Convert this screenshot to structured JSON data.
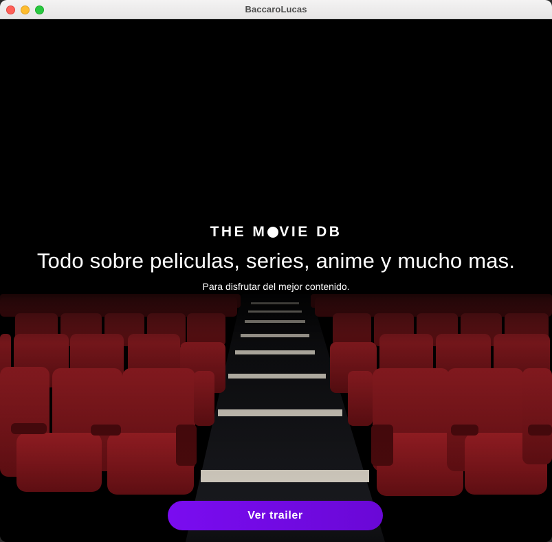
{
  "window": {
    "title": "BaccaroLucas"
  },
  "hero": {
    "logo_left": "THE M",
    "logo_right": "VIE DB",
    "headline": "Todo sobre peliculas, series, anime y mucho mas.",
    "subtitle": "Para disfrutar del mejor contenido."
  },
  "cta": {
    "label": "Ver trailer"
  },
  "colors": {
    "accent": "#7a0cf0",
    "seat": "#8e1a1f",
    "background": "#000000"
  }
}
